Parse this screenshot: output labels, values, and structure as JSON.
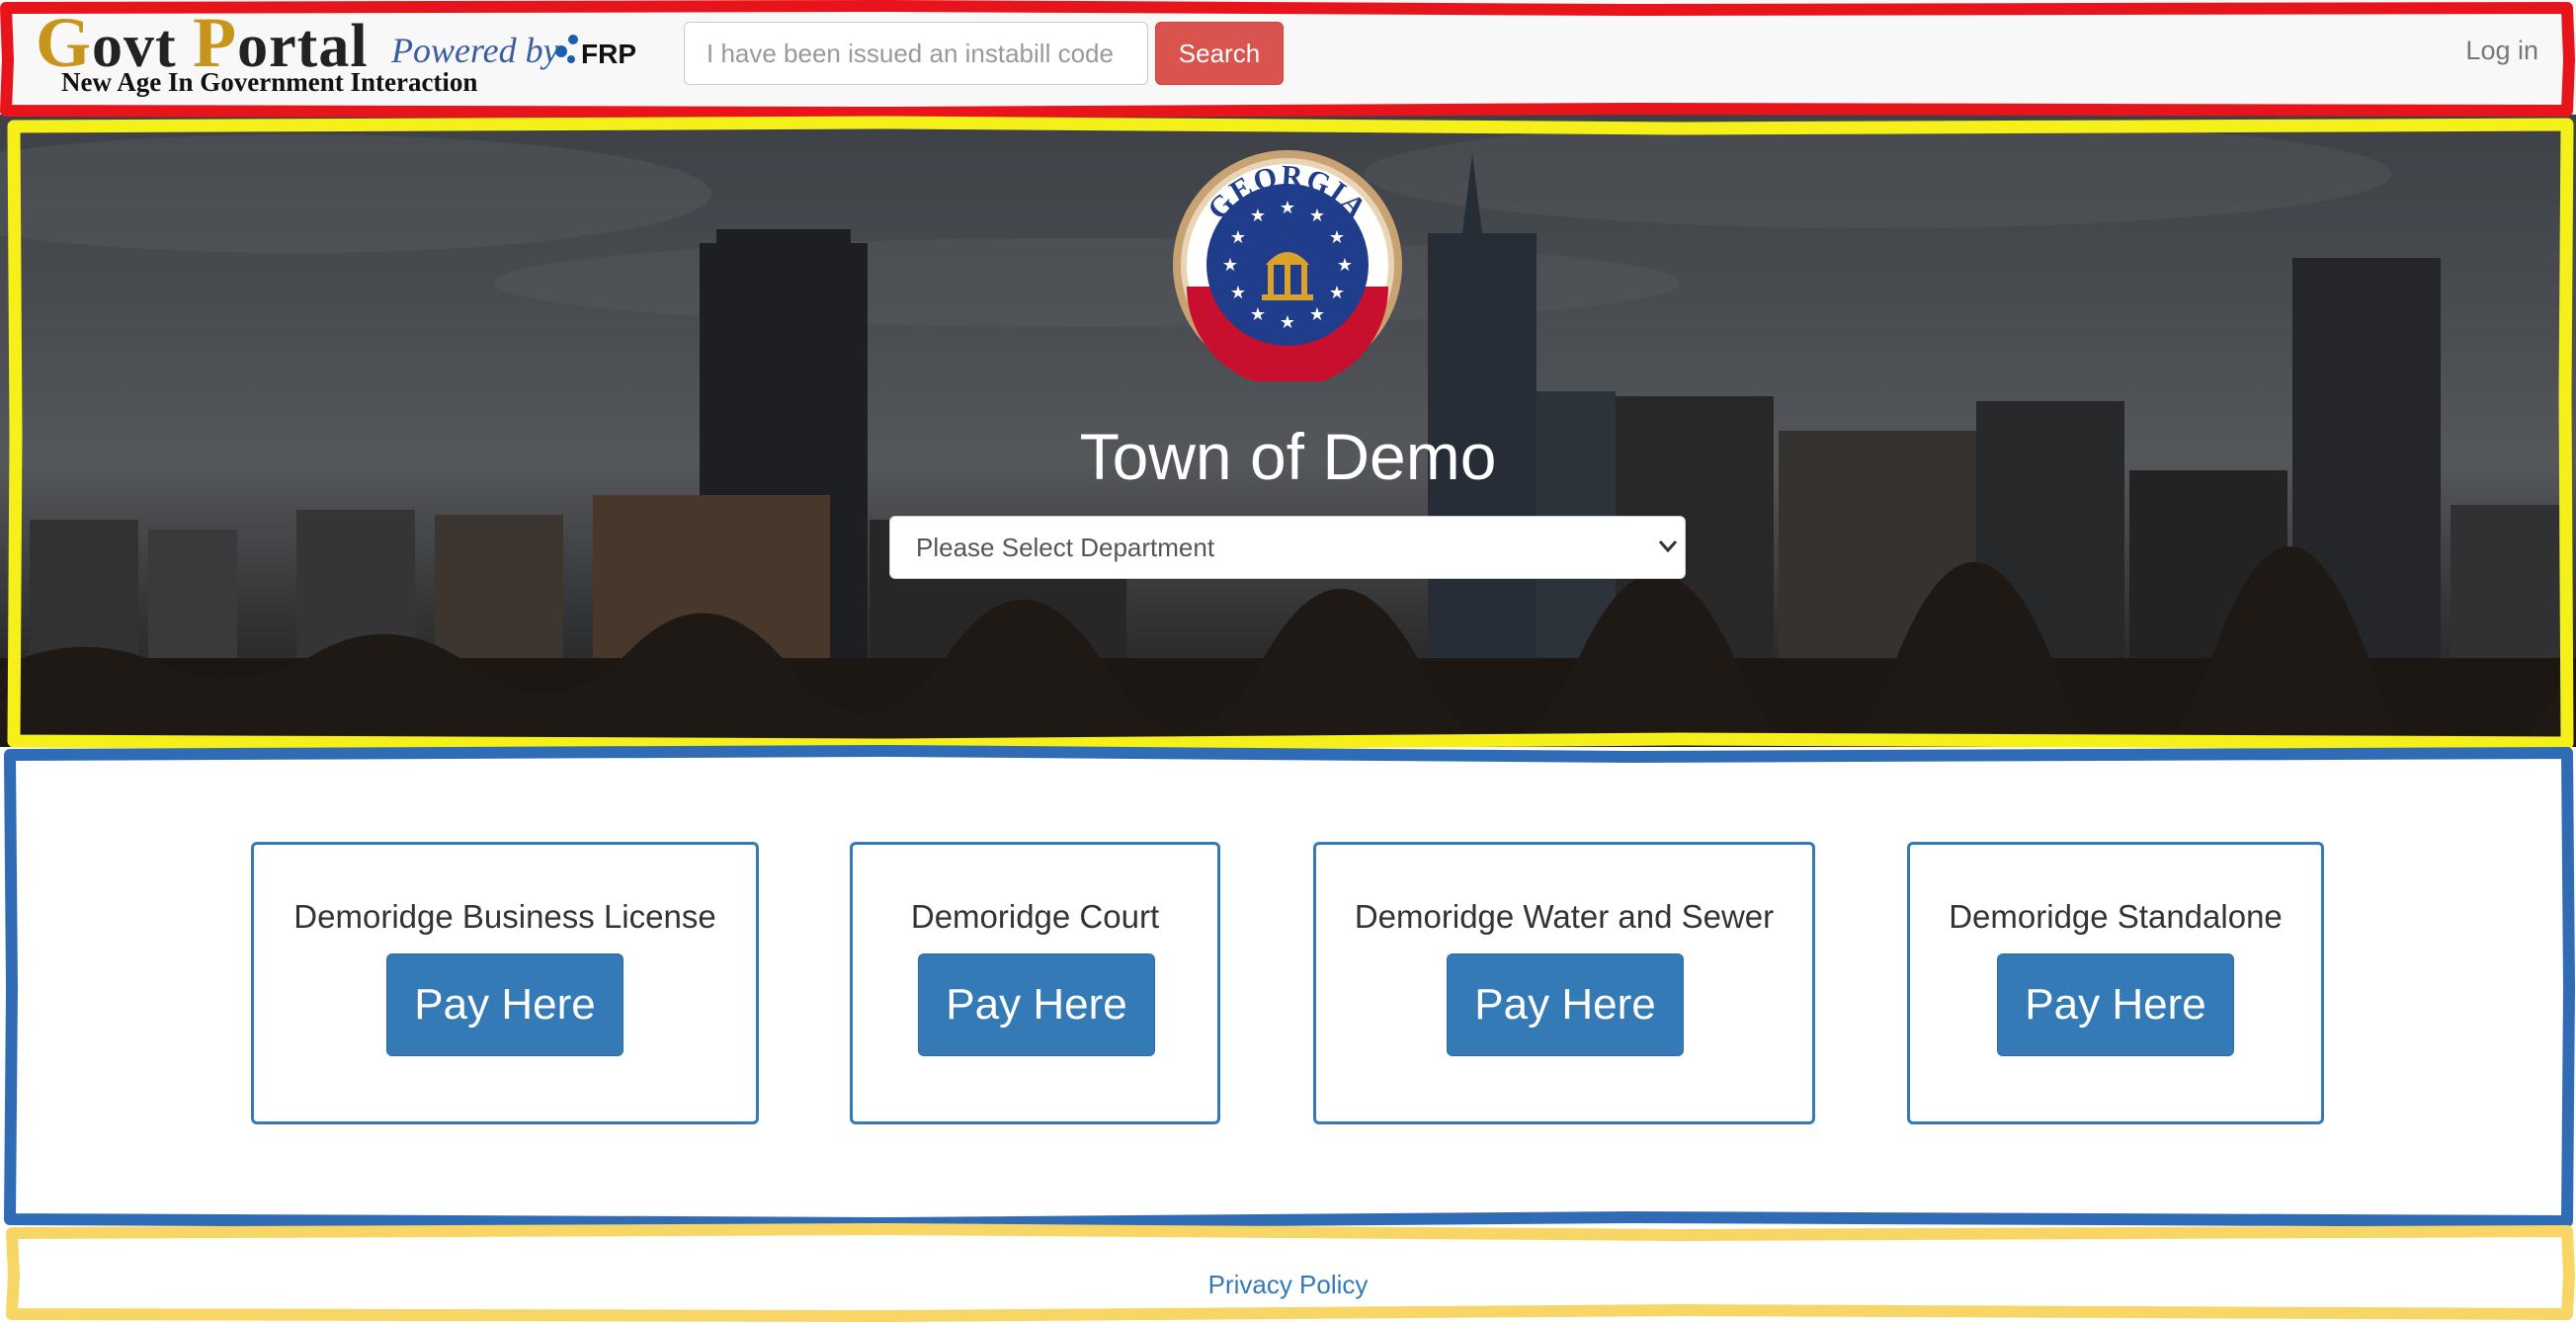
{
  "navbar": {
    "logo": {
      "main_letter_1": "G",
      "main_text_1": "ovt ",
      "main_letter_2": "P",
      "main_text_2": "ortal",
      "powered_by": "Powered by",
      "brand": "FRP",
      "tagline": "New Age In Government Interaction"
    },
    "search": {
      "placeholder": "I have been issued an instabill code",
      "button_label": "Search"
    },
    "login_label": "Log in"
  },
  "hero": {
    "seal": {
      "top_text": "GEORGIA",
      "colors": {
        "outer_ring": "#c8a272",
        "blue": "#1f3d8a",
        "red": "#c8102e",
        "gold": "#d9a22a"
      }
    },
    "town_name": "Town of Demo",
    "department_select": {
      "selected": "Please Select Department"
    }
  },
  "cards": [
    {
      "title": "Demoridge Business License",
      "button_label": "Pay Here"
    },
    {
      "title": "Demoridge Court",
      "button_label": "Pay Here"
    },
    {
      "title": "Demoridge Water and Sewer",
      "button_label": "Pay Here"
    },
    {
      "title": "Demoridge Standalone",
      "button_label": "Pay Here"
    }
  ],
  "footer": {
    "privacy_label": "Privacy Policy"
  },
  "colors": {
    "accent_blue": "#337ab7",
    "search_red": "#d9534f",
    "annotation_red": "#e8141c",
    "annotation_yellow": "#f5ef1a",
    "annotation_blue": "#2f6cb5",
    "annotation_gold": "#f7d666"
  }
}
